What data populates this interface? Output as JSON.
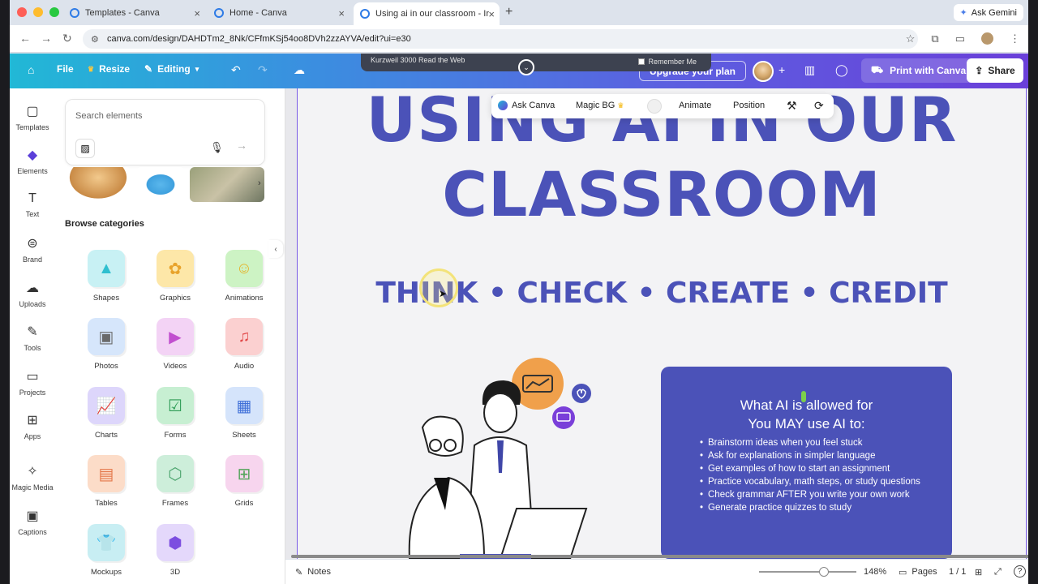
{
  "browser": {
    "tabs": [
      {
        "label": "Templates - Canva"
      },
      {
        "label": "Home - Canva"
      },
      {
        "label": "Using ai in our classroom - Ir"
      }
    ],
    "new_tab": "+",
    "ask_gemini": "Ask Gemini",
    "url": "canva.com/design/DAHDTm2_8Nk/CFfmKSj54oo8DVh2zzAYVA/edit?ui=e30"
  },
  "kurzweil": {
    "title": "Kurzweil 3000 Read the Web",
    "remember": "Remember Me"
  },
  "header": {
    "file": "File",
    "resize": "Resize",
    "editing": "Editing",
    "upgrade": "Upgrade your plan",
    "print": "Print with Canva",
    "share": "Share"
  },
  "rail": {
    "items": [
      {
        "label": "Templates"
      },
      {
        "label": "Elements"
      },
      {
        "label": "Text"
      },
      {
        "label": "Brand"
      },
      {
        "label": "Uploads"
      },
      {
        "label": "Tools"
      },
      {
        "label": "Projects"
      },
      {
        "label": "Apps"
      },
      {
        "label": "Magic Media"
      },
      {
        "label": "Captions"
      }
    ]
  },
  "panel": {
    "search_placeholder": "Search elements",
    "browse": "Browse categories",
    "categories": [
      {
        "label": "Shapes"
      },
      {
        "label": "Graphics"
      },
      {
        "label": "Animations"
      },
      {
        "label": "Photos"
      },
      {
        "label": "Videos"
      },
      {
        "label": "Audio"
      },
      {
        "label": "Charts"
      },
      {
        "label": "Forms"
      },
      {
        "label": "Sheets"
      },
      {
        "label": "Tables"
      },
      {
        "label": "Frames"
      },
      {
        "label": "Grids"
      },
      {
        "label": "Mockups"
      },
      {
        "label": "3D"
      }
    ]
  },
  "floatbar": {
    "ask": "Ask Canva",
    "magic_bg": "Magic BG",
    "animate": "Animate",
    "position": "Position"
  },
  "slide": {
    "title_line1": "USING AI IN OUR",
    "title_line2": "CLASSROOM",
    "subtitle": "THINK • CHECK • CREATE • CREDIT",
    "box_heading1": "What AI is allowed for",
    "box_heading2": "You MAY use AI to:",
    "bullets": [
      "Brainstorm ideas when you feel stuck",
      "Ask for explanations in simpler language",
      "Get examples of how to start an assignment",
      "Practice vocabulary, math steps, or study questions",
      "Check grammar AFTER you write your own work",
      "Generate practice quizzes to study"
    ]
  },
  "bottom": {
    "notes": "Notes",
    "zoom": "148%",
    "pages": "Pages",
    "page_count": "1 / 1"
  },
  "colors": {
    "brand_purple": "#4b52b8",
    "accent_violet": "#6a3fd9",
    "accent_teal": "#21b8d6"
  }
}
